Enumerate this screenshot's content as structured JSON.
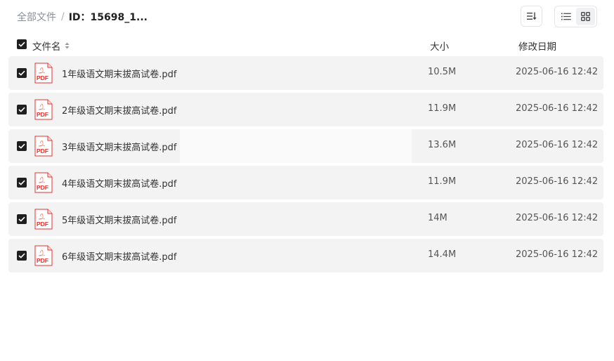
{
  "breadcrumb": {
    "root": "全部文件",
    "separator": "/",
    "current": "ID：15698_1..."
  },
  "toolbar": {
    "sort_icon": "sort-list-icon",
    "list_view_icon": "list-view-icon",
    "grid_view_icon": "grid-view-icon",
    "active_view": "list"
  },
  "table": {
    "columns": {
      "name": "文件名",
      "size": "大小",
      "date": "修改日期"
    },
    "pdf_label": "PDF",
    "rows": [
      {
        "name": "1年级语文期末拔高试卷.pdf",
        "size": "10.5M",
        "date": "2025-06-16 12:42",
        "checked": true
      },
      {
        "name": "2年级语文期末拔高试卷.pdf",
        "size": "11.9M",
        "date": "2025-06-16 12:42",
        "checked": true
      },
      {
        "name": "3年级语文期末拔高试卷.pdf",
        "size": "13.6M",
        "date": "2025-06-16 12:42",
        "checked": true
      },
      {
        "name": "4年级语文期末拔高试卷.pdf",
        "size": "11.9M",
        "date": "2025-06-16 12:42",
        "checked": true
      },
      {
        "name": "5年级语文期末拔高试卷.pdf",
        "size": "14M",
        "date": "2025-06-16 12:42",
        "checked": true
      },
      {
        "name": "6年级语文期末拔高试卷.pdf",
        "size": "14.4M",
        "date": "2025-06-16 12:42",
        "checked": true
      }
    ]
  },
  "colors": {
    "row_bg": "#f3f3f4",
    "checkbox": "#1f1f1f",
    "pdf_red": "#e5322d"
  }
}
